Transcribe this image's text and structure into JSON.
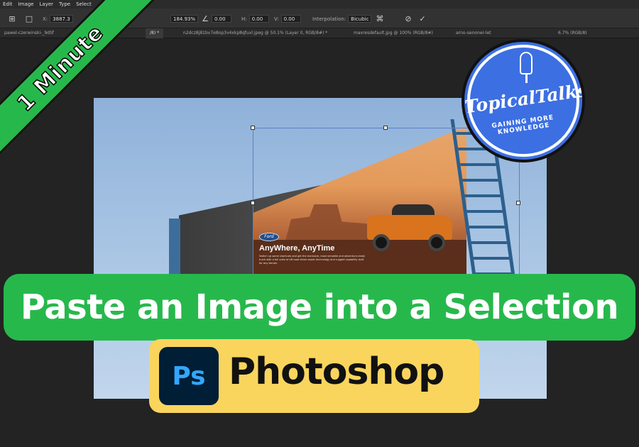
{
  "menu": [
    "Edit",
    "Image",
    "Layer",
    "Type",
    "Select"
  ],
  "options_bar": {
    "x_label": "X:",
    "x_value": "3887.3",
    "w_percent": "184.93%",
    "angle_value": "0.00",
    "h_label": "H:",
    "h_value": "0.00",
    "v_label": "V:",
    "v_value": "0.00",
    "interpolation_label": "Interpolation:",
    "interpolation_value": "Bicubic"
  },
  "tabs": [
    "pawel-czerwinski-_9dSf",
    "/8) *",
    "n2dcz8j81bv7e8op3v4xkp8qfuxl.jpeg @ 50.1% (Layer 0, RGB/8#) *",
    "maxresdefault.jpg @ 100% (RGB/8#)",
    "arno-senoner-let",
    "6.7% (RGB/8)"
  ],
  "billboard": {
    "brand": "Ford",
    "headline": "AnyWhere, AnyTime",
    "body": "Switch up some shortcuts and get the exclusive, most versatile and adventure-ready truck with a full suite of off-road driver-assist technology and rugged capability built for any terrain."
  },
  "ribbon_text": "1 Minute",
  "logo": {
    "title": "TopicalTalks",
    "subtitle": "GAINING MORE KNOWLEDGE"
  },
  "title_banner": "Paste an Image into a Selection",
  "app": {
    "icon_text": "Ps",
    "name": "Photoshop"
  },
  "colors": {
    "green": "#27b84c",
    "yellow": "#f9d55e",
    "ps_dark": "#001e36",
    "ps_blue": "#31a8ff",
    "logo_blue": "#3c6fe2"
  }
}
